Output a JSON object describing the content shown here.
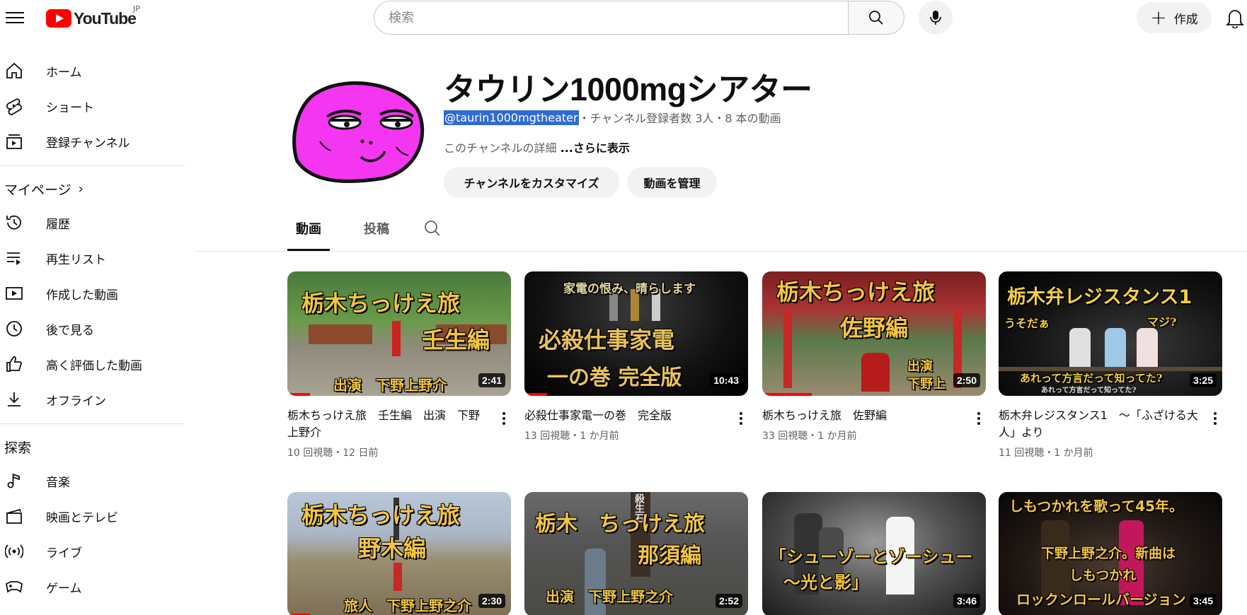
{
  "header": {
    "logo_text": "YouTube",
    "country": "JP",
    "search_placeholder": "検索",
    "create_label": "作成"
  },
  "sidebar": {
    "top_items": [
      {
        "label": "ホーム",
        "icon": "home-icon"
      },
      {
        "label": "ショート",
        "icon": "shorts-icon"
      },
      {
        "label": "登録チャンネル",
        "icon": "subscriptions-icon"
      }
    ],
    "you_section": "マイページ",
    "you_items": [
      {
        "label": "履歴",
        "icon": "history-icon"
      },
      {
        "label": "再生リスト",
        "icon": "playlist-icon"
      },
      {
        "label": "作成した動画",
        "icon": "your-videos-icon"
      },
      {
        "label": "後で見る",
        "icon": "watch-later-icon"
      },
      {
        "label": "高く評価した動画",
        "icon": "liked-videos-icon"
      },
      {
        "label": "オフライン",
        "icon": "download-icon"
      }
    ],
    "explore_section": "探索",
    "explore_items": [
      {
        "label": "音楽",
        "icon": "music-icon"
      },
      {
        "label": "映画とテレビ",
        "icon": "movies-icon"
      },
      {
        "label": "ライブ",
        "icon": "live-icon"
      },
      {
        "label": "ゲーム",
        "icon": "gaming-icon"
      }
    ]
  },
  "channel": {
    "name": "タウリン1000mgシアター",
    "handle": "@taurin1000mgtheater",
    "meta": "・チャンネル登録者数 3人・8 本の動画",
    "description": "このチャンネルの詳細",
    "more_label": "...さらに表示",
    "customize_label": "チャンネルをカスタマイズ",
    "manage_label": "動画を管理",
    "avatar_color": "#f536f0"
  },
  "tabs": [
    {
      "label": "動画",
      "active": true
    },
    {
      "label": "投稿",
      "active": false
    }
  ],
  "videos": [
    {
      "title": "栃木ちっけえ旅　壬生編　出演　下野上野介",
      "stats": "10 回視聴・12 日前",
      "duration": "2:41",
      "thumb_text": [
        "栃木ちっけえ旅",
        "壬生編",
        "出演　下野上野介"
      ],
      "progress": 0.1
    },
    {
      "title": "必殺仕事家電一の巻　完全版",
      "stats": "13 回視聴・1 か月前",
      "duration": "10:43",
      "thumb_text": [
        "家電の恨み、晴らします",
        "必殺仕事家電",
        "一の巻 完全版"
      ],
      "progress": 0.1
    },
    {
      "title": "栃木ちっけえ旅　佐野編",
      "stats": "33 回視聴・1 か月前",
      "duration": "2:50",
      "thumb_text": [
        "栃木ちっけえ旅",
        "佐野編",
        "出演",
        "下野上"
      ],
      "progress": 0.22
    },
    {
      "title": "栃木弁レジスタンス1　～「ふざける大人」より",
      "stats": "11 回視聴・1 か月前",
      "duration": "3:25",
      "thumb_text": [
        "栃木弁レジスタンス1",
        "うそだぁ",
        "マジ?",
        "あれって方言だって知ってた?",
        "あれって方言だって知ってた?"
      ],
      "progress": 0
    },
    {
      "title": "",
      "stats": "",
      "duration": "2:30",
      "thumb_text": [
        "栃木ちっけえ旅",
        "野木編",
        "旅人　下野上野之介"
      ],
      "progress": 0.1
    },
    {
      "title": "",
      "stats": "",
      "duration": "2:52",
      "thumb_text": [
        "栃木　ちっけえ旅",
        "那須編",
        "出演　下野上野之介",
        "殺生石"
      ],
      "progress": 0
    },
    {
      "title": "",
      "stats": "",
      "duration": "3:46",
      "thumb_text": [
        "「シューゾーとゾーシュー",
        "～光と影」"
      ],
      "progress": 0
    },
    {
      "title": "",
      "stats": "",
      "duration": "3:45",
      "thumb_text": [
        "しもつかれを歌って45年。",
        "下野上野之介。新曲は",
        "しもつかれ",
        "ロックンロールバージョン"
      ],
      "progress": 0
    }
  ]
}
